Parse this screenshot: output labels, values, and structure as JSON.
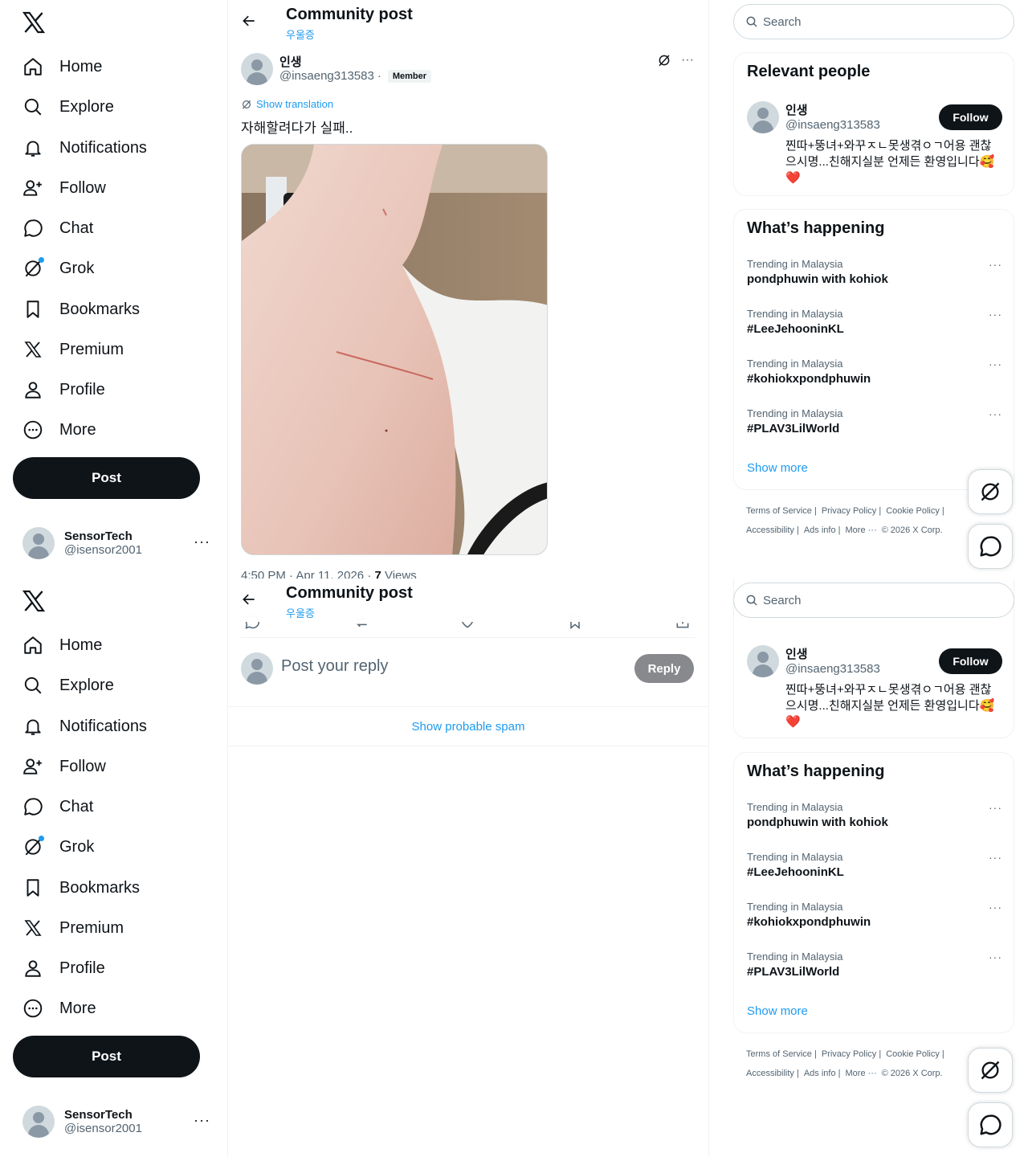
{
  "nav": {
    "items": [
      {
        "label": "Home",
        "icon": "home-icon"
      },
      {
        "label": "Explore",
        "icon": "search-icon"
      },
      {
        "label": "Notifications",
        "icon": "bell-icon"
      },
      {
        "label": "Follow",
        "icon": "add-person-icon"
      },
      {
        "label": "Chat",
        "icon": "chat-bubble-icon"
      },
      {
        "label": "Grok",
        "icon": "grok-icon"
      },
      {
        "label": "Bookmarks",
        "icon": "bookmark-icon"
      },
      {
        "label": "Premium",
        "icon": "x-logo-icon"
      },
      {
        "label": "Profile",
        "icon": "person-icon"
      },
      {
        "label": "More",
        "icon": "more-circle-icon"
      }
    ],
    "post_label": "Post"
  },
  "account": {
    "name": "SensorTech",
    "handle": "@isensor2001",
    "dots": "···"
  },
  "header": {
    "title": "Community post",
    "community": "우울증"
  },
  "post": {
    "author_name": "인생",
    "author_handle": "@insaeng313583",
    "separator": "·",
    "badge": "Member",
    "more": "···",
    "translate_label": "Show translation",
    "text": "자해할려다가 실패..",
    "time": "4:50 PM · Apr 11, 2026 · ",
    "views_count": "7",
    "views_label": " Views"
  },
  "reply": {
    "placeholder": "Post your reply",
    "button": "Reply"
  },
  "spam_label": "Show probable spam",
  "search": {
    "placeholder": "Search"
  },
  "relevant": {
    "title": "Relevant people",
    "name": "인생",
    "handle": "@insaeng313583",
    "follow_label": "Follow",
    "bio": "찐따+뚱녀+와꾸ㅈㄴ못생겪ㅇㄱ어용 괜찮으시명...친해지실분 언제든 환영입니다🥰❤️"
  },
  "happening": {
    "title": "What’s happening",
    "trends": [
      {
        "context": "Trending in Malaysia",
        "topic": "pondphuwin with kohiok"
      },
      {
        "context": "Trending in Malaysia",
        "topic": "#LeeJehooninKL"
      },
      {
        "context": "Trending in Malaysia",
        "topic": "#kohiokxpondphuwin"
      },
      {
        "context": "Trending in Malaysia",
        "topic": "#PLAV3LilWorld"
      }
    ],
    "show_more": "Show more",
    "more_dots": "···"
  },
  "footer": {
    "links": [
      "Terms of Service |",
      "Privacy Policy |",
      "Cookie Policy |"
    ],
    "links2": [
      "Accessibility |",
      "Ads info |",
      "More ···",
      "© 2026 X Corp."
    ]
  },
  "colors": {
    "accent": "#1d9bf0",
    "text": "#0f1419",
    "muted": "#536471",
    "border": "#eff3f4"
  }
}
